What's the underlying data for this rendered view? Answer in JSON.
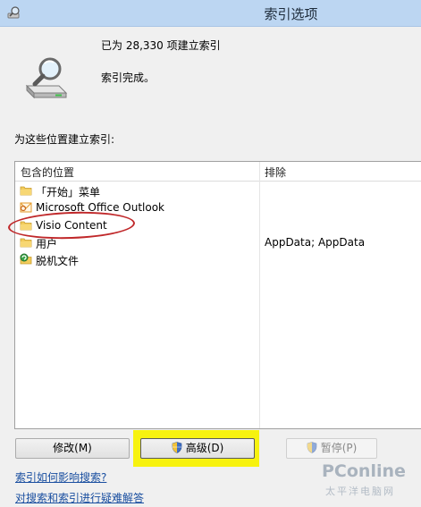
{
  "window": {
    "title": "索引选项"
  },
  "summary": {
    "count_text": "已为 28,330 项建立索引",
    "status_text": "索引完成。"
  },
  "section_label": "为这些位置建立索引:",
  "list": {
    "headers": {
      "included": "包含的位置",
      "excluded": "排除"
    },
    "rows": [
      {
        "label": "「开始」菜单",
        "exclude": "",
        "icon": "folder-icon"
      },
      {
        "label": "Microsoft Office Outlook",
        "exclude": "",
        "icon": "outlook-icon"
      },
      {
        "label": "Visio Content",
        "exclude": "",
        "icon": "folder-icon"
      },
      {
        "label": "用户",
        "exclude": "AppData; AppData",
        "icon": "folder-icon"
      },
      {
        "label": "脱机文件",
        "exclude": "",
        "icon": "offline-files-icon"
      }
    ]
  },
  "buttons": {
    "modify": "修改(M)",
    "advanced": "高级(D)",
    "pause": "暂停(P)"
  },
  "links": {
    "how_indexing_affects_search": "索引如何影响搜索?",
    "troubleshoot": "对搜索和索引进行疑难解答"
  },
  "watermark": {
    "logo": "PConline",
    "sub": "太平洋电脑网"
  },
  "colors": {
    "annotation_ellipse": "#c0282a",
    "annotation_highlight": "#f7f20f",
    "link": "#1a4fa0"
  }
}
